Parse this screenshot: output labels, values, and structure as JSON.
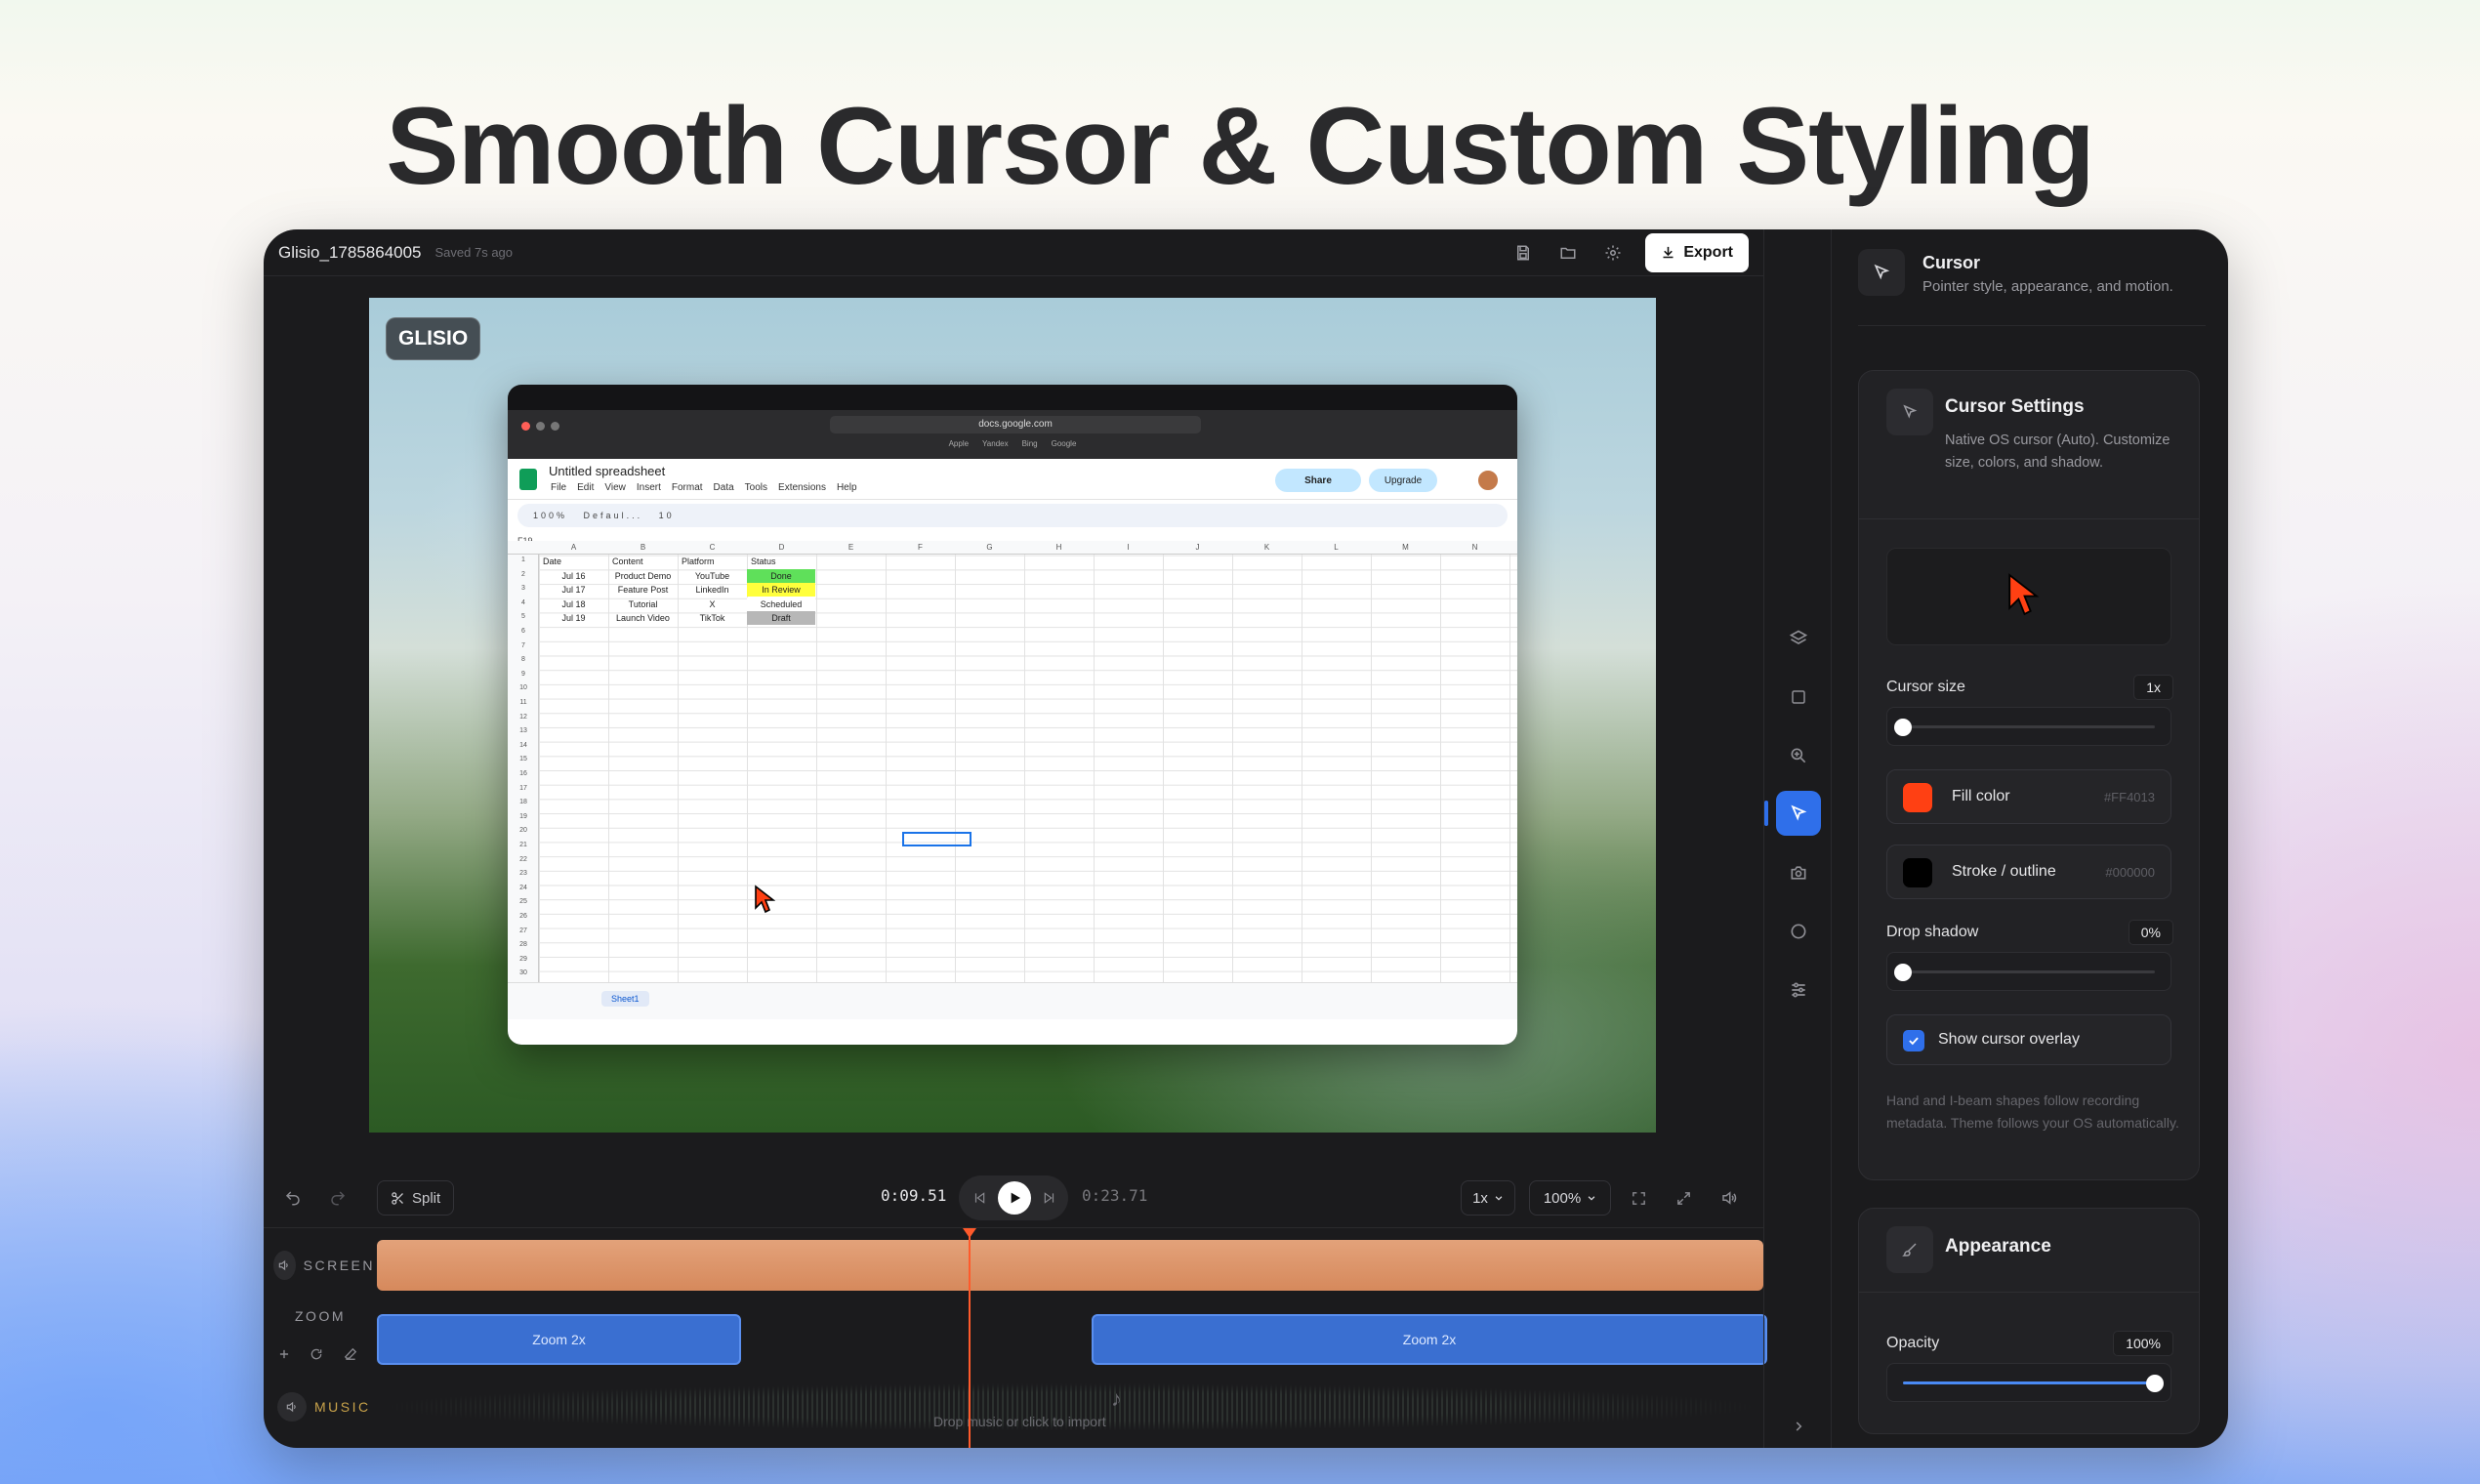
{
  "headline": "Smooth Cursor & Custom Styling",
  "topbar": {
    "project_name": "Glisio_1785864005",
    "saved_text": "Saved 7s ago",
    "export_label": "Export"
  },
  "preview": {
    "badge": "GLISIO",
    "browser": {
      "url": "docs.google.com",
      "bookmarks": [
        "Apple",
        "Yandex",
        "Bing",
        "Google"
      ]
    },
    "sheet": {
      "title": "Untitled spreadsheet",
      "menu": [
        "File",
        "Edit",
        "View",
        "Insert",
        "Format",
        "Data",
        "Tools",
        "Extensions",
        "Help"
      ],
      "share": "Share",
      "upgrade": "Upgrade",
      "zoom": "100%",
      "font": "Defaul...",
      "font_size": "10",
      "name_box": "F19",
      "columns": [
        "A",
        "B",
        "C",
        "D",
        "E",
        "F",
        "G",
        "H",
        "I",
        "J",
        "K",
        "L",
        "M",
        "N"
      ],
      "headers": [
        "Date",
        "Content",
        "Platform",
        "Status"
      ],
      "rows": [
        [
          "Jul 16",
          "Product Demo",
          "YouTube",
          "Done"
        ],
        [
          "Jul 17",
          "Feature Post",
          "LinkedIn",
          "In Review"
        ],
        [
          "Jul 18",
          "Tutorial",
          "X",
          "Scheduled"
        ],
        [
          "Jul 19",
          "Launch Video",
          "TikTok",
          "Draft"
        ]
      ],
      "status_colors": [
        "#5fe05a",
        "#ffff3c",
        "#ffffff",
        "#b7b7b7"
      ],
      "tab": "Sheet1"
    }
  },
  "player": {
    "split_label": "Split",
    "current_time": "0:09.51",
    "total_time": "0:23.71",
    "speed": "1x",
    "zoom": "100%"
  },
  "timeline": {
    "screen_label": "SCREEN",
    "zoom_label": "ZOOM",
    "music_label": "MUSIC",
    "zoom_clips": [
      "Zoom 2x",
      "Zoom 2x"
    ],
    "music_hint": "Drop music or click to import"
  },
  "panel": {
    "title": "Cursor",
    "subtitle": "Pointer style, appearance, and motion.",
    "settings": {
      "title": "Cursor Settings",
      "description": "Native OS cursor (Auto). Customize size, colors, and shadow.",
      "size_label": "Cursor size",
      "size_value": "1x",
      "size_fraction": 0,
      "fill_label": "Fill color",
      "fill_hex": "#FF4013",
      "stroke_label": "Stroke / outline",
      "stroke_hex": "#000000",
      "shadow_label": "Drop shadow",
      "shadow_value": "0%",
      "shadow_fraction": 0,
      "overlay_label": "Show cursor overlay",
      "overlay_checked": true,
      "note": "Hand and I-beam shapes follow recording metadata. Theme follows your OS automatically."
    },
    "appearance": {
      "title": "Appearance",
      "opacity_label": "Opacity",
      "opacity_value": "100%",
      "opacity_fraction": 1
    }
  },
  "colors": {
    "accent": "#2f6fea",
    "playhead": "#ff5a2b",
    "screen_track": "#d6895c",
    "zoom_clip": "#3a6fd1",
    "cursor_fill": "#FF4013"
  }
}
